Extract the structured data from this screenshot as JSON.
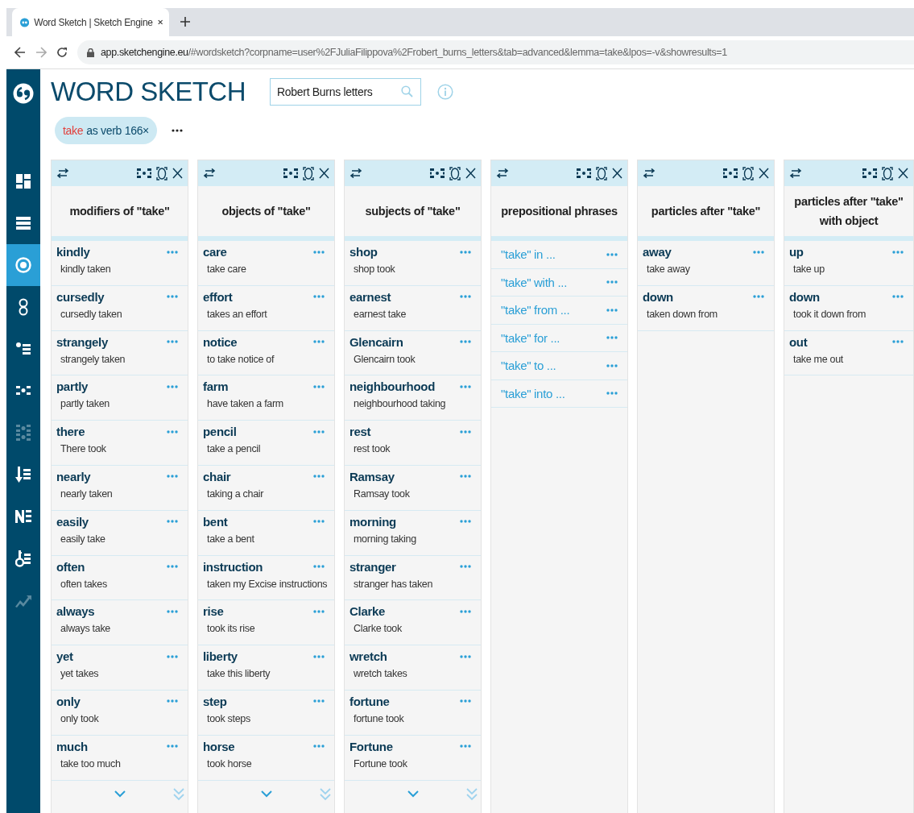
{
  "browser": {
    "tab": {
      "title": "Word Sketch | Sketch Engine"
    },
    "url": {
      "host": "app.sketchengine.eu",
      "path": "/#wordsketch?corpname=user%2FJuliaFilippova%2Frobert_burns_letters&tab=advanced&lemma=take&lpos=-v&showresults=1"
    }
  },
  "sidebar": {
    "items": [
      {
        "selected": false,
        "disabled": false
      },
      {
        "selected": false,
        "disabled": false
      },
      {
        "selected": true,
        "disabled": false
      },
      {
        "selected": false,
        "disabled": false
      },
      {
        "selected": false,
        "disabled": false
      },
      {
        "selected": false,
        "disabled": false
      },
      {
        "selected": false,
        "disabled": true
      },
      {
        "selected": false,
        "disabled": false
      },
      {
        "selected": false,
        "disabled": false
      },
      {
        "selected": false,
        "disabled": false
      },
      {
        "selected": false,
        "disabled": true
      }
    ]
  },
  "header": {
    "title": "WORD SKETCH",
    "corpus_field": {
      "value": "Robert Burns letters"
    }
  },
  "query_chip": {
    "lemma": "take",
    "details": "as verb 166×"
  },
  "columns": [
    {
      "title": "modifiers of \"take\"",
      "kind": "collocations",
      "has_more": true,
      "rows": [
        {
          "word": "kindly",
          "example": "kindly taken"
        },
        {
          "word": "cursedly",
          "example": "cursedly taken"
        },
        {
          "word": "strangely",
          "example": "strangely taken"
        },
        {
          "word": "partly",
          "example": "partly taken"
        },
        {
          "word": "there",
          "example": "There took"
        },
        {
          "word": "nearly",
          "example": "nearly taken"
        },
        {
          "word": "easily",
          "example": "easily take"
        },
        {
          "word": "often",
          "example": "often takes"
        },
        {
          "word": "always",
          "example": "always take"
        },
        {
          "word": "yet",
          "example": "yet takes"
        },
        {
          "word": "only",
          "example": "only took"
        },
        {
          "word": "much",
          "example": "take too much"
        }
      ]
    },
    {
      "title": "objects of \"take\"",
      "kind": "collocations",
      "has_more": true,
      "rows": [
        {
          "word": "care",
          "example": "take care"
        },
        {
          "word": "effort",
          "example": "takes an effort"
        },
        {
          "word": "notice",
          "example": "to take notice of"
        },
        {
          "word": "farm",
          "example": "have taken a farm"
        },
        {
          "word": "pencil",
          "example": "take a pencil"
        },
        {
          "word": "chair",
          "example": "taking a chair"
        },
        {
          "word": "bent",
          "example": "take a bent"
        },
        {
          "word": "instruction",
          "example": "taken my Excise instructions"
        },
        {
          "word": "rise",
          "example": "took its rise"
        },
        {
          "word": "liberty",
          "example": "take this liberty"
        },
        {
          "word": "step",
          "example": "took steps"
        },
        {
          "word": "horse",
          "example": "took horse"
        }
      ]
    },
    {
      "title": "subjects of \"take\"",
      "kind": "collocations",
      "has_more": true,
      "rows": [
        {
          "word": "shop",
          "example": "shop took"
        },
        {
          "word": "earnest",
          "example": "earnest take"
        },
        {
          "word": "Glencairn",
          "example": "Glencairn took"
        },
        {
          "word": "neighbourhood",
          "example": "neighbourhood taking"
        },
        {
          "word": "rest",
          "example": "rest took"
        },
        {
          "word": "Ramsay",
          "example": "Ramsay took"
        },
        {
          "word": "morning",
          "example": "morning taking"
        },
        {
          "word": "stranger",
          "example": "stranger has taken"
        },
        {
          "word": "Clarke",
          "example": "Clarke took"
        },
        {
          "word": "wretch",
          "example": "wretch takes"
        },
        {
          "word": "fortune",
          "example": "fortune took"
        },
        {
          "word": "Fortune",
          "example": "Fortune took"
        }
      ]
    },
    {
      "title": "prepositional phrases",
      "kind": "phrases",
      "has_more": false,
      "rows": [
        {
          "word": "\"take\" in ..."
        },
        {
          "word": "\"take\" with ..."
        },
        {
          "word": "\"take\" from ..."
        },
        {
          "word": "\"take\" for ..."
        },
        {
          "word": "\"take\" to ..."
        },
        {
          "word": "\"take\" into ..."
        }
      ]
    },
    {
      "title": "particles after \"take\"",
      "kind": "collocations",
      "has_more": false,
      "rows": [
        {
          "word": "away",
          "example": "take away"
        },
        {
          "word": "down",
          "example": "taken down from"
        }
      ]
    },
    {
      "title": "particles after \"take\" with object",
      "kind": "collocations",
      "has_more": false,
      "rows": [
        {
          "word": "up",
          "example": "take up"
        },
        {
          "word": "down",
          "example": "took it down from"
        },
        {
          "word": "out",
          "example": "take me out"
        }
      ]
    }
  ]
}
